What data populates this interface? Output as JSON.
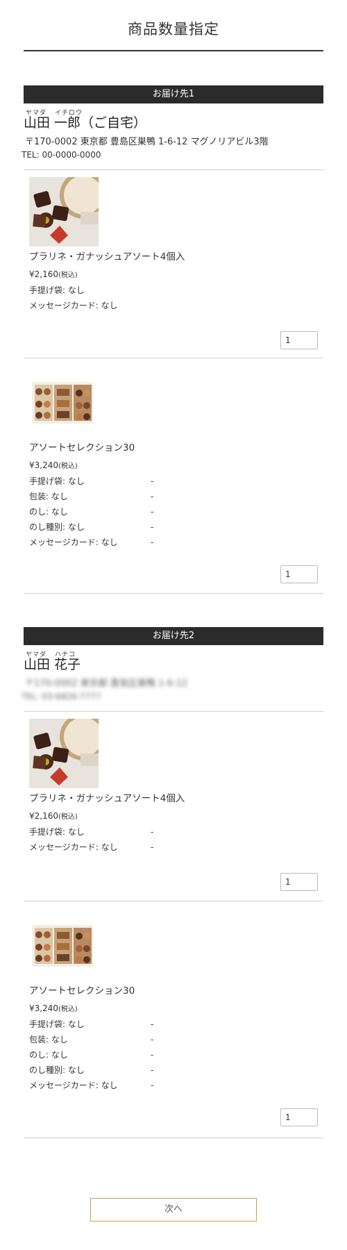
{
  "page": {
    "title": "商品数量指定"
  },
  "destinations": [
    {
      "header": "お届け先1",
      "kana_last": "ヤマダ",
      "kana_first": "イチロウ",
      "name": "山田 一郎（ご自宅）",
      "address": "〒170-0002 東京都 豊島区巣鴨 1-6-12 マグノリアビル3階",
      "tel": "TEL: 00-0000-0000",
      "items": [
        {
          "name": "プラリネ・ガナッシュアソート4個入",
          "price": "¥2,160",
          "tax": "(税込)",
          "options": [
            {
              "label": "手提げ袋: なし",
              "dash": ""
            },
            {
              "label": "メッセージカード: なし",
              "dash": ""
            }
          ],
          "qty": "1"
        },
        {
          "name": "アソートセレクション30",
          "price": "¥3,240",
          "tax": "(税込)",
          "options": [
            {
              "label": "手提げ袋: なし",
              "dash": "-"
            },
            {
              "label": "包装: なし",
              "dash": "-"
            },
            {
              "label": "のし: なし",
              "dash": "-"
            },
            {
              "label": "のし種別: なし",
              "dash": "-"
            },
            {
              "label": "メッセージカード: なし",
              "dash": "-"
            }
          ],
          "qty": "1"
        }
      ]
    },
    {
      "header": "お届け先2",
      "kana_last": "ヤマダ",
      "kana_first": "ハナコ",
      "name": "山田 花子",
      "address": "〒170-0002 東京都 豊島区巣鴨 1-6-12",
      "tel": "TEL: 03-6826-7777",
      "items": [
        {
          "name": "プラリネ・ガナッシュアソート4個入",
          "price": "¥2,160",
          "tax": "(税込)",
          "options": [
            {
              "label": "手提げ袋: なし",
              "dash": "-"
            },
            {
              "label": "メッセージカード: なし",
              "dash": "-"
            }
          ],
          "qty": "1"
        },
        {
          "name": "アソートセレクション30",
          "price": "¥3,240",
          "tax": "(税込)",
          "options": [
            {
              "label": "手提げ袋: なし",
              "dash": "-"
            },
            {
              "label": "包装: なし",
              "dash": "-"
            },
            {
              "label": "のし: なし",
              "dash": "-"
            },
            {
              "label": "のし種別: なし",
              "dash": "-"
            },
            {
              "label": "メッセージカード: なし",
              "dash": "-"
            }
          ],
          "qty": "1"
        }
      ]
    }
  ],
  "next_label": "次へ",
  "colors": {
    "header_bg": "#2b2b2b",
    "button_border": "#c9a24a",
    "divider": "#cfcfcf"
  }
}
